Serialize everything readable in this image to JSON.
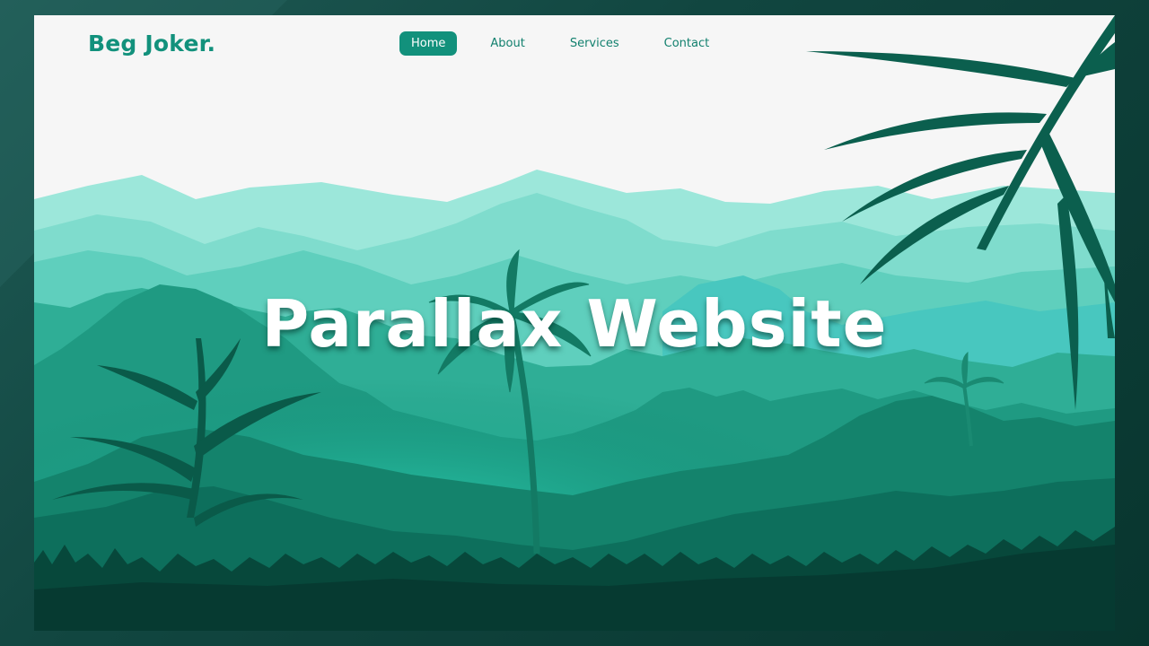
{
  "brand": {
    "logo": "Beg Joker."
  },
  "nav": {
    "items": [
      {
        "label": "Home",
        "active": true
      },
      {
        "label": "About",
        "active": false
      },
      {
        "label": "Services",
        "active": false
      },
      {
        "label": "Contact",
        "active": false
      }
    ]
  },
  "hero": {
    "title": "Parallax Website"
  },
  "colors": {
    "accent": "#12917c",
    "sky": "#f6f6f6",
    "foreground": "#063a31"
  },
  "icons": [
    "palm-tree-icon",
    "fern-icon",
    "grass-icon"
  ]
}
